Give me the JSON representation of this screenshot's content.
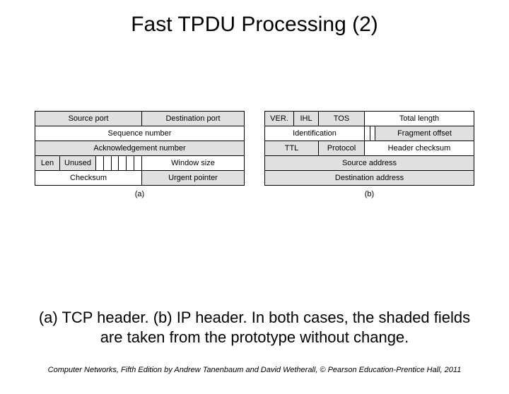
{
  "title": "Fast TPDU Processing (2)",
  "tcp": {
    "source_port": "Source port",
    "dest_port": "Destination  port",
    "seq": "Sequence number",
    "ack": "Acknowledgement number",
    "len": "Len",
    "unused": "Unused",
    "window": "Window size",
    "checksum": "Checksum",
    "urgent": "Urgent pointer",
    "sub": "(a)"
  },
  "ip": {
    "ver": "VER.",
    "ihl": "IHL",
    "tos": "TOS",
    "total_len": "Total length",
    "ident": "Identification",
    "frag": "Fragment offset",
    "ttl": "TTL",
    "protocol": "Protocol",
    "checksum": "Header checksum",
    "src": "Source address",
    "dst": "Destination address",
    "sub": "(b)"
  },
  "caption": "(a) TCP header. (b) IP header. In both cases, the shaded fields are taken from the prototype without change.",
  "footer": "Computer Networks, Fifth Edition by Andrew Tanenbaum and David Wetherall, © Pearson Education-Prentice Hall, 2011"
}
